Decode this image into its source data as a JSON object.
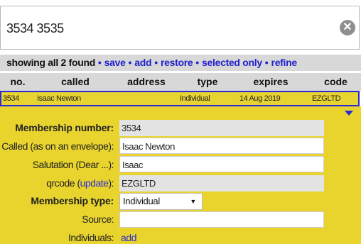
{
  "search": {
    "value": "3534 3535",
    "clear_icon": "clear-circle-icon"
  },
  "summary": {
    "count_text": "showing all 2 found",
    "separator": "•",
    "links": [
      "save",
      "add",
      "restore",
      "selected only",
      "refine"
    ]
  },
  "table": {
    "columns": [
      "no.",
      "called",
      "address",
      "type",
      "expires",
      "code"
    ],
    "rows": [
      {
        "no": "3534",
        "called": "Isaac Newton",
        "address": "",
        "type": "Individual",
        "expires": "14 Aug 2019",
        "code": "EZGLTD"
      }
    ]
  },
  "detail": {
    "expand_icon": "triangle-down-icon",
    "membership_number": {
      "label": "Membership number:",
      "value": "3534"
    },
    "called": {
      "label": "Called (as on an envelope):",
      "value": "Isaac Newton"
    },
    "salutation": {
      "label": "Salutation (Dear ...):",
      "value": "Isaac"
    },
    "qrcode": {
      "label_prefix": "qrcode (",
      "label_link": "update",
      "label_suffix": "):",
      "value": "EZGLTD"
    },
    "membership_type": {
      "label": "Membership type:",
      "value": "Individual",
      "arrow": "▼"
    },
    "source": {
      "label": "Source:",
      "value": ""
    },
    "individuals": {
      "label": "Individuals:",
      "link": "add"
    }
  },
  "colors": {
    "accent_yellow": "#e9d42e",
    "link_blue": "#2222cc",
    "header_grey": "#d8d8d8"
  }
}
